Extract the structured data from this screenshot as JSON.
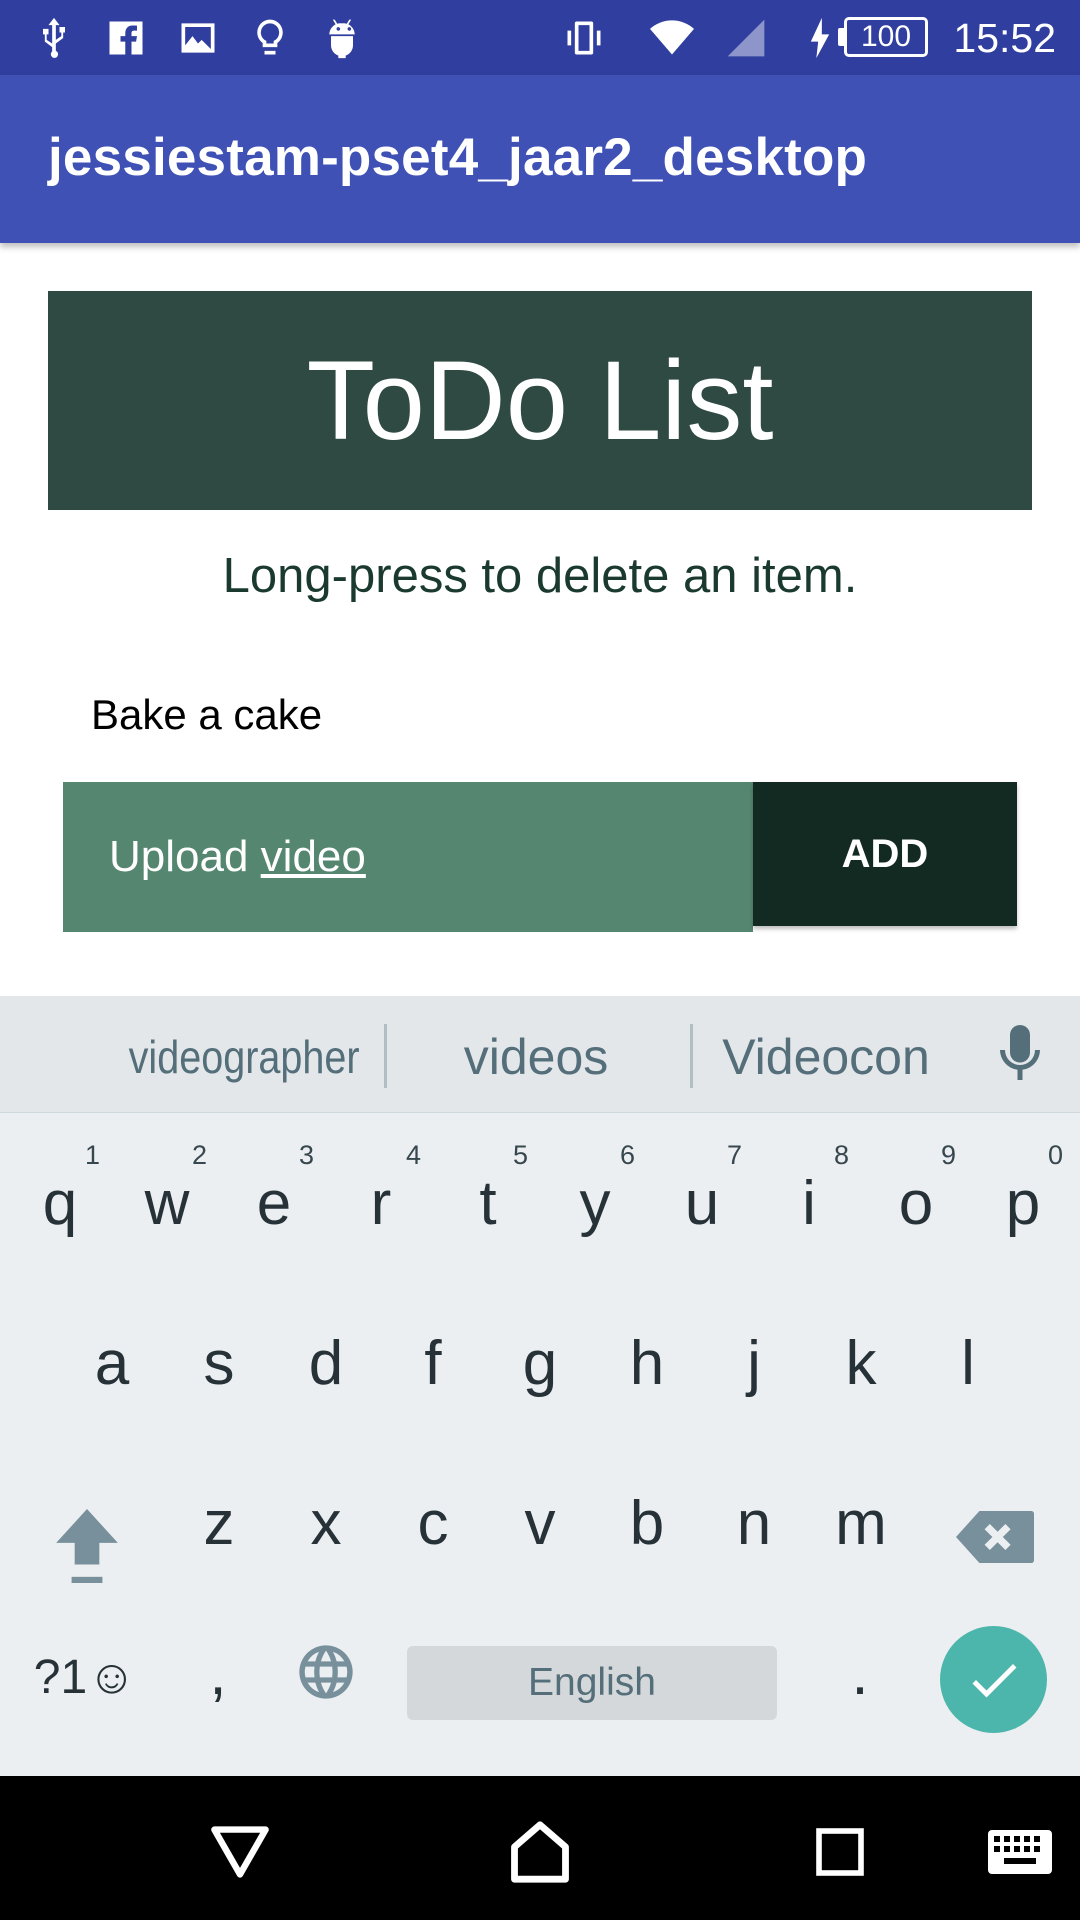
{
  "status_bar": {
    "left_icons": [
      "usb-icon",
      "facebook-icon",
      "image-icon",
      "lightbulb-icon",
      "android-icon"
    ],
    "right_icons": [
      "vibrate-icon",
      "wifi-icon",
      "signal-icon",
      "charging-icon"
    ],
    "battery": "100",
    "time": "15:52"
  },
  "app_bar": {
    "title": "jessiestam-pset4_jaar2_desktop"
  },
  "header": {
    "title": "ToDo List"
  },
  "hint": "Long-press to delete an item.",
  "todo_items": [
    {
      "label": "Bake a cake"
    }
  ],
  "input": {
    "value_prefix": "Upload ",
    "value_current_word": "video"
  },
  "add_button": {
    "label": "ADD"
  },
  "keyboard": {
    "suggestions": [
      "videographer",
      "videos",
      "Videocon"
    ],
    "row1": [
      {
        "k": "q",
        "d": "1"
      },
      {
        "k": "w",
        "d": "2"
      },
      {
        "k": "e",
        "d": "3"
      },
      {
        "k": "r",
        "d": "4"
      },
      {
        "k": "t",
        "d": "5"
      },
      {
        "k": "y",
        "d": "6"
      },
      {
        "k": "u",
        "d": "7"
      },
      {
        "k": "i",
        "d": "8"
      },
      {
        "k": "o",
        "d": "9"
      },
      {
        "k": "p",
        "d": "0"
      }
    ],
    "row2": [
      "a",
      "s",
      "d",
      "f",
      "g",
      "h",
      "j",
      "k",
      "l"
    ],
    "row3": [
      "z",
      "x",
      "c",
      "v",
      "b",
      "n",
      "m"
    ],
    "symbols_label": "?1☺",
    "comma_label": ",",
    "space_label": "English",
    "period_label": "."
  },
  "colors": {
    "status_bar": "#303F9F",
    "app_bar": "#3F51B5",
    "header_box": "#2F4A42",
    "input_bg": "#558770",
    "add_button": "#132A23",
    "enter_key": "#4DB6AC"
  }
}
